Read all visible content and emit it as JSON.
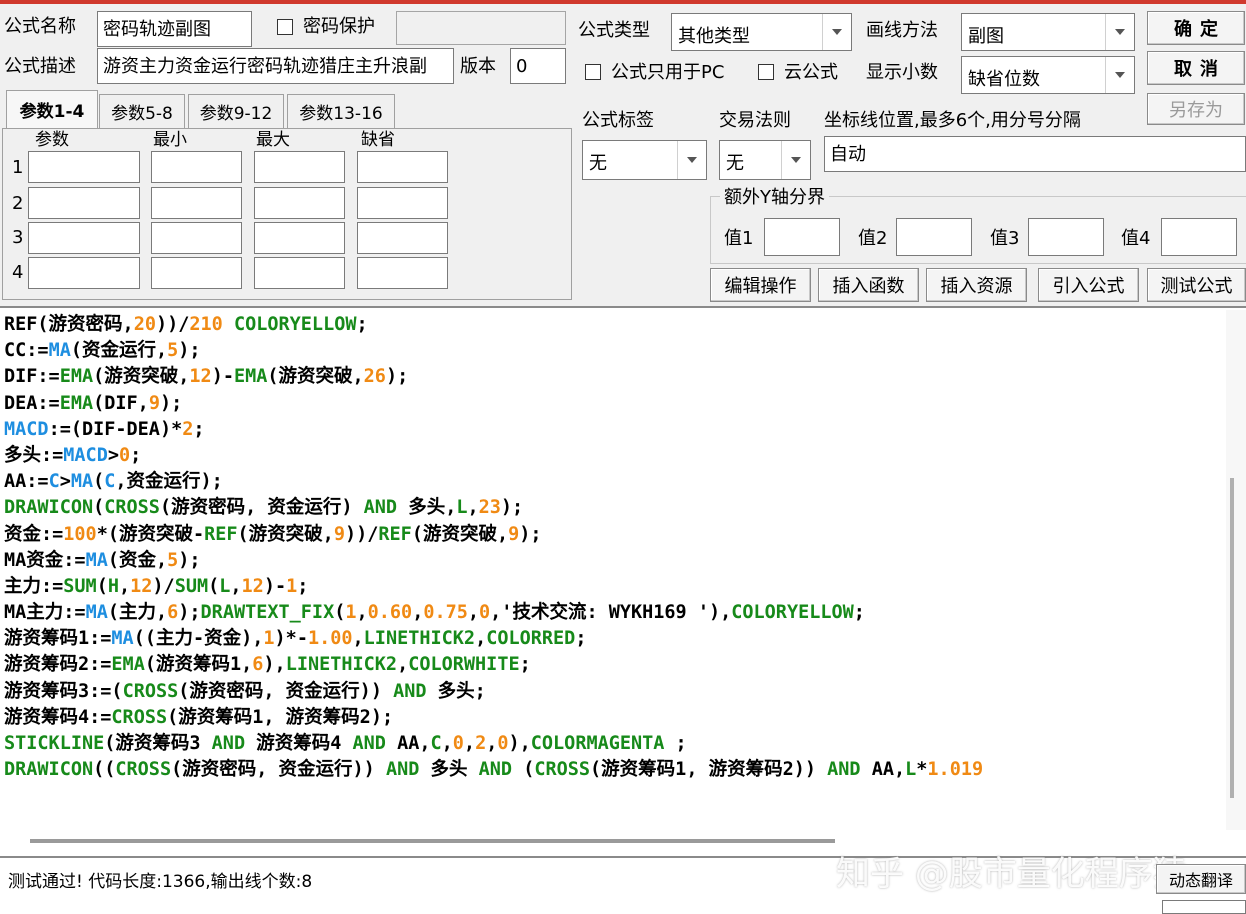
{
  "form": {
    "name_label": "公式名称",
    "name_value": "密码轨迹副图",
    "password_label": "密码保护",
    "desc_label": "公式描述",
    "desc_value": "游资主力资金运行密码轨迹猎庄主升浪副",
    "version_label": "版本",
    "version_value": "0",
    "type_label": "公式类型",
    "type_value": "其他类型",
    "draw_label": "画线方法",
    "draw_value": "副图",
    "pc_only_label": "公式只用于PC",
    "cloud_label": "云公式",
    "decimals_label": "显示小数",
    "decimals_value": "缺省位数",
    "tag_label": "公式标签",
    "tag_value": "无",
    "rule_label": "交易法则",
    "rule_value": "无",
    "axis_label": "坐标线位置,最多6个,用分号分隔",
    "axis_value": "自动",
    "yaxis_group_label": "额外Y轴分界",
    "yaxis_values": [
      "值1",
      "值2",
      "值3",
      "值4"
    ]
  },
  "buttons": {
    "ok": "确定",
    "cancel": "取消",
    "save_as": "另存为",
    "edit_ops": "编辑操作",
    "insert_func": "插入函数",
    "insert_res": "插入资源",
    "import_formula": "引入公式",
    "test_formula": "测试公式",
    "dynamic_translate": "动态翻译"
  },
  "params": {
    "tabs": [
      "参数1-4",
      "参数5-8",
      "参数9-12",
      "参数13-16"
    ],
    "headers": [
      "参数",
      "最小",
      "最大",
      "缺省"
    ],
    "rows": [
      "1",
      "2",
      "3",
      "4"
    ]
  },
  "code_lines": [
    [
      [
        "t",
        "REF(游资密码,"
      ],
      [
        "n",
        "20"
      ],
      [
        "t",
        "))/"
      ],
      [
        "n",
        "210"
      ],
      [
        "t",
        " "
      ],
      [
        "k",
        "COLORYELLOW"
      ],
      [
        "t",
        ";"
      ]
    ],
    [
      [
        "t",
        "CC:="
      ],
      [
        "f",
        "MA"
      ],
      [
        "t",
        "(资金运行,"
      ],
      [
        "n",
        "5"
      ],
      [
        "t",
        ");"
      ]
    ],
    [
      [
        "t",
        "DIF:="
      ],
      [
        "k",
        "EMA"
      ],
      [
        "t",
        "(游资突破,"
      ],
      [
        "n",
        "12"
      ],
      [
        "t",
        ")-"
      ],
      [
        "k",
        "EMA"
      ],
      [
        "t",
        "(游资突破,"
      ],
      [
        "n",
        "26"
      ],
      [
        "t",
        ");"
      ]
    ],
    [
      [
        "t",
        "DEA:="
      ],
      [
        "k",
        "EMA"
      ],
      [
        "t",
        "(DIF,"
      ],
      [
        "n",
        "9"
      ],
      [
        "t",
        ");"
      ]
    ],
    [
      [
        "f",
        "MACD"
      ],
      [
        "t",
        ":=(DIF-DEA)*"
      ],
      [
        "n",
        "2"
      ],
      [
        "t",
        ";"
      ]
    ],
    [
      [
        "t",
        "多头:="
      ],
      [
        "f",
        "MACD"
      ],
      [
        "t",
        ">"
      ],
      [
        "n",
        "0"
      ],
      [
        "t",
        ";"
      ]
    ],
    [
      [
        "t",
        "AA:="
      ],
      [
        "f",
        "C"
      ],
      [
        "t",
        ">"
      ],
      [
        "f",
        "MA"
      ],
      [
        "t",
        "("
      ],
      [
        "f",
        "C"
      ],
      [
        "t",
        ",资金运行);"
      ]
    ],
    [
      [
        "k",
        "DRAWICON"
      ],
      [
        "t",
        "("
      ],
      [
        "k",
        "CROSS"
      ],
      [
        "t",
        "(游资密码, 资金运行) "
      ],
      [
        "k",
        "AND"
      ],
      [
        "t",
        " 多头,"
      ],
      [
        "k",
        "L"
      ],
      [
        "t",
        ","
      ],
      [
        "n",
        "23"
      ],
      [
        "t",
        ");"
      ]
    ],
    [
      [
        "t",
        "资金:="
      ],
      [
        "n",
        "100"
      ],
      [
        "t",
        "*(游资突破-"
      ],
      [
        "k",
        "REF"
      ],
      [
        "t",
        "(游资突破,"
      ],
      [
        "n",
        "9"
      ],
      [
        "t",
        "))/"
      ],
      [
        "k",
        "REF"
      ],
      [
        "t",
        "(游资突破,"
      ],
      [
        "n",
        "9"
      ],
      [
        "t",
        ");"
      ]
    ],
    [
      [
        "t",
        "MA资金:="
      ],
      [
        "f",
        "MA"
      ],
      [
        "t",
        "(资金,"
      ],
      [
        "n",
        "5"
      ],
      [
        "t",
        ");"
      ]
    ],
    [
      [
        "t",
        "主力:="
      ],
      [
        "k",
        "SUM"
      ],
      [
        "t",
        "("
      ],
      [
        "k",
        "H"
      ],
      [
        "t",
        ","
      ],
      [
        "n",
        "12"
      ],
      [
        "t",
        ")/"
      ],
      [
        "k",
        "SUM"
      ],
      [
        "t",
        "("
      ],
      [
        "k",
        "L"
      ],
      [
        "t",
        ","
      ],
      [
        "n",
        "12"
      ],
      [
        "t",
        ")-"
      ],
      [
        "n",
        "1"
      ],
      [
        "t",
        ";"
      ]
    ],
    [
      [
        "t",
        "MA主力:="
      ],
      [
        "f",
        "MA"
      ],
      [
        "t",
        "(主力,"
      ],
      [
        "n",
        "6"
      ],
      [
        "t",
        ");"
      ],
      [
        "k",
        "DRAWTEXT_FIX"
      ],
      [
        "t",
        "("
      ],
      [
        "n",
        "1"
      ],
      [
        "t",
        ","
      ],
      [
        "n",
        "0.60"
      ],
      [
        "t",
        ","
      ],
      [
        "n",
        "0.75"
      ],
      [
        "t",
        ","
      ],
      [
        "n",
        "0"
      ],
      [
        "t",
        ",'技术交流: WYKH169 '),"
      ],
      [
        "k",
        "COLORYELLOW"
      ],
      [
        "t",
        ";"
      ]
    ],
    [
      [
        "t",
        "游资筹码1:="
      ],
      [
        "f",
        "MA"
      ],
      [
        "t",
        "((主力-资金),"
      ],
      [
        "n",
        "1"
      ],
      [
        "t",
        ")*-"
      ],
      [
        "n",
        "1.00"
      ],
      [
        "t",
        ","
      ],
      [
        "k",
        "LINETHICK2"
      ],
      [
        "t",
        ","
      ],
      [
        "k",
        "COLORRED"
      ],
      [
        "t",
        ";"
      ]
    ],
    [
      [
        "t",
        "游资筹码2:="
      ],
      [
        "k",
        "EMA"
      ],
      [
        "t",
        "(游资筹码1,"
      ],
      [
        "n",
        "6"
      ],
      [
        "t",
        "),"
      ],
      [
        "k",
        "LINETHICK2"
      ],
      [
        "t",
        ","
      ],
      [
        "k",
        "COLORWHITE"
      ],
      [
        "t",
        ";"
      ]
    ],
    [
      [
        "t",
        "游资筹码3:=("
      ],
      [
        "k",
        "CROSS"
      ],
      [
        "t",
        "(游资密码, 资金运行)) "
      ],
      [
        "k",
        "AND"
      ],
      [
        "t",
        " 多头;"
      ]
    ],
    [
      [
        "t",
        "游资筹码4:="
      ],
      [
        "k",
        "CROSS"
      ],
      [
        "t",
        "(游资筹码1, 游资筹码2);"
      ]
    ],
    [
      [
        "k",
        "STICKLINE"
      ],
      [
        "t",
        "(游资筹码3 "
      ],
      [
        "k",
        "AND"
      ],
      [
        "t",
        " 游资筹码4 "
      ],
      [
        "k",
        "AND"
      ],
      [
        "t",
        " AA,"
      ],
      [
        "k",
        "C"
      ],
      [
        "t",
        ","
      ],
      [
        "n",
        "0"
      ],
      [
        "t",
        ","
      ],
      [
        "n",
        "2"
      ],
      [
        "t",
        ","
      ],
      [
        "n",
        "0"
      ],
      [
        "t",
        "),"
      ],
      [
        "k",
        "COLORMAGENTA"
      ],
      [
        "t",
        " ;"
      ]
    ],
    [
      [
        "k",
        "DRAWICON"
      ],
      [
        "t",
        "(("
      ],
      [
        "k",
        "CROSS"
      ],
      [
        "t",
        "(游资密码, 资金运行)) "
      ],
      [
        "k",
        "AND"
      ],
      [
        "t",
        " 多头 "
      ],
      [
        "k",
        "AND"
      ],
      [
        "t",
        " ("
      ],
      [
        "k",
        "CROSS"
      ],
      [
        "t",
        "(游资筹码1, 游资筹码2)) "
      ],
      [
        "k",
        "AND"
      ],
      [
        "t",
        " AA,"
      ],
      [
        "k",
        "L"
      ],
      [
        "t",
        "*"
      ],
      [
        "n",
        "1.019"
      ]
    ]
  ],
  "status": {
    "message": "测试通过! 代码长度:1366,输出线个数:8"
  },
  "watermark": "知乎 @股市量化程序猿"
}
